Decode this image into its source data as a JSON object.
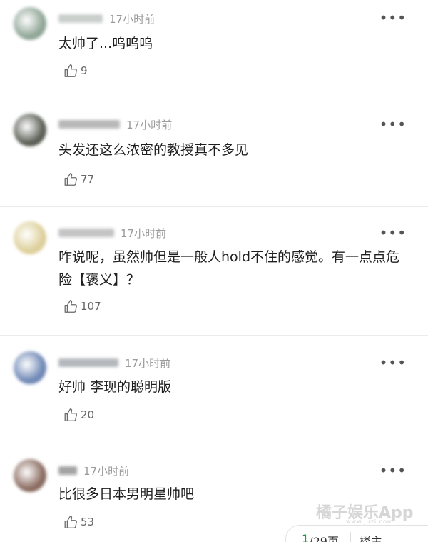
{
  "comments": [
    {
      "time": "17小时前",
      "text": "太帅了...呜呜呜",
      "likes": "9",
      "avatar_color": "#8fa596",
      "name_color": "#c9cfcb",
      "more": "•••"
    },
    {
      "time": "17小时前",
      "text": "头发还这么浓密的教授真不多见",
      "likes": "77",
      "avatar_color": "#5b5e55",
      "name_color": "#b8b8b8",
      "more": "•••"
    },
    {
      "time": "17小时前",
      "text": "咋说呢，虽然帅但是一般人hold不住的感觉。有一点点危险【褒义】？",
      "likes": "107",
      "avatar_color": "#ddcf9a",
      "name_color": "#c4c4c4",
      "more": "•••"
    },
    {
      "time": "17小时前",
      "text": "好帅 李现的聪明版",
      "likes": "20",
      "avatar_color": "#6f88b5",
      "name_color": "#b4b7bc",
      "more": "•••"
    },
    {
      "time": "17小时前",
      "text": "比很多日本男明星帅吧",
      "likes": "53",
      "avatar_color": "#8a6b60",
      "name_color": "#a3a3a3",
      "more": "•••"
    }
  ],
  "pagination": {
    "current": "1",
    "total_suffix": "/29页",
    "floor_label": "楼主"
  },
  "watermark": {
    "text": "橘子娱乐App",
    "sub": "www.juzi.com"
  }
}
